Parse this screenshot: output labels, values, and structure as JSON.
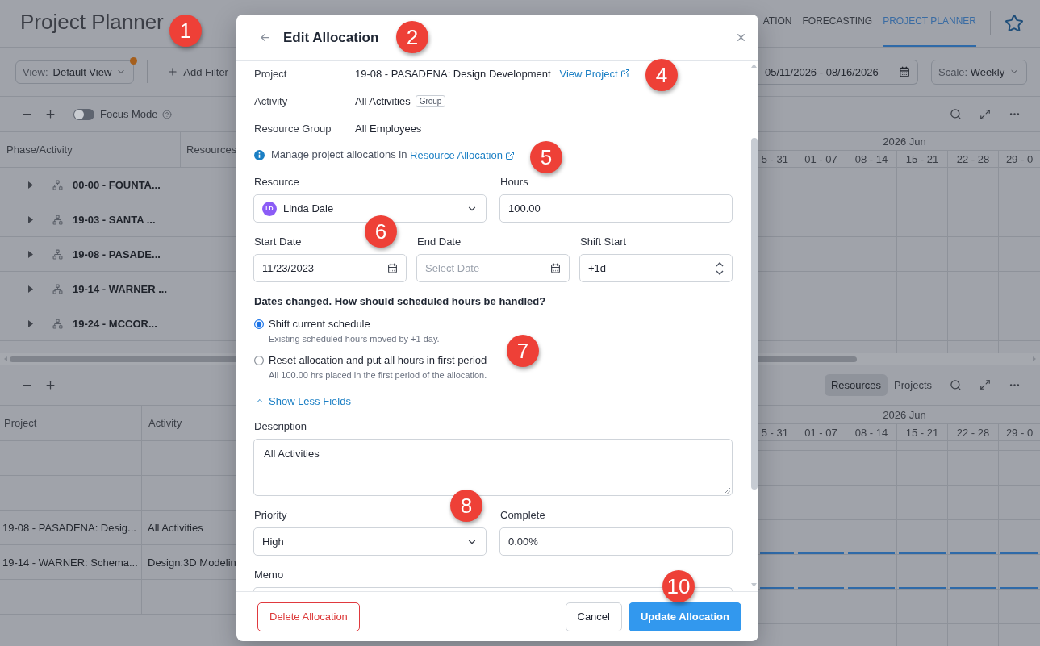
{
  "header": {
    "title": "Project Planner",
    "nav_tabs": [
      {
        "label": "ATION",
        "selected": false
      },
      {
        "label": "FORECASTING",
        "selected": false
      },
      {
        "label": "PROJECT PLANNER",
        "selected": true
      }
    ]
  },
  "toolbar": {
    "view": {
      "label": "View:",
      "value": "Default View",
      "modified": true
    },
    "add_filter": "Add Filter",
    "date_range": "05/11/2026 - 08/16/2026",
    "scale": {
      "label": "Scale:",
      "value": "Weekly"
    }
  },
  "upper_panel": {
    "focus_mode": {
      "label": "Focus Mode",
      "on": false
    },
    "columns": [
      "Phase/Activity",
      "Resources"
    ],
    "timeline": {
      "month": "2026 Jun",
      "weeks": [
        "5 - 31",
        "01 - 07",
        "08 - 14",
        "15 - 21",
        "22 - 28",
        "29 - 0"
      ]
    },
    "rows": [
      {
        "label": "00-00 - FOUNTA...",
        "expanded": false
      },
      {
        "label": "19-03 - SANTA ...",
        "expanded": false
      },
      {
        "label": "19-08 - PASADE...",
        "expanded": false
      },
      {
        "label": "19-14 - WARNER ...",
        "expanded": false
      },
      {
        "label": "19-24 - MCCOR...",
        "expanded": false
      }
    ]
  },
  "lower_panel": {
    "view_toggle": [
      {
        "label": "Resources",
        "selected": true
      },
      {
        "label": "Projects",
        "selected": false
      }
    ],
    "columns": [
      "Project",
      "Activity"
    ],
    "timeline": {
      "month": "2026 Jun",
      "weeks": [
        "5 - 31",
        "01 - 07",
        "08 - 14",
        "15 - 21",
        "22 - 28",
        "29 - 0"
      ]
    },
    "rows": [
      {
        "allocated": false
      },
      {
        "allocated": false
      },
      {
        "project": "19-08 - PASADENA: Desig...",
        "activity": "All Activities",
        "allocated": true
      },
      {
        "project": "19-14 - WARNER: Schema...",
        "activity": "Design:3D Modelin",
        "allocated": true
      },
      {
        "allocated": false
      }
    ]
  },
  "dialog": {
    "title": "Edit Allocation",
    "details": [
      {
        "label": "Project",
        "value": "19-08 - PASADENA: Design Development",
        "link": "View Project"
      },
      {
        "label": "Activity",
        "value": "All Activities",
        "badge": "Group"
      },
      {
        "label": "Resource Group",
        "value": "All Employees"
      }
    ],
    "info": {
      "text": "Manage project allocations in",
      "link": "Resource Allocation"
    },
    "resource": {
      "label": "Resource",
      "value": "Linda Dale",
      "initials": "LD"
    },
    "hours": {
      "label": "Hours",
      "value": "100.00"
    },
    "start_date": {
      "label": "Start Date",
      "value": "11/23/2023"
    },
    "end_date": {
      "label": "End Date",
      "placeholder": "Select Date"
    },
    "shift_start": {
      "label": "Shift Start",
      "value": "+1d"
    },
    "question": "Dates changed. How should scheduled hours be handled?",
    "options": [
      {
        "label": "Shift current schedule",
        "hint": "Existing scheduled hours moved by +1 day.",
        "selected": true
      },
      {
        "label": "Reset allocation and put all hours in first period",
        "hint": "All 100.00 hrs placed in the first period of the allocation.",
        "selected": false
      }
    ],
    "fields_toggle": {
      "label": "Show Less Fields",
      "expanded": true
    },
    "description": {
      "label": "Description",
      "value": "All Activities"
    },
    "priority": {
      "label": "Priority",
      "value": "High"
    },
    "complete": {
      "label": "Complete",
      "value": "0.00%"
    },
    "memo": {
      "label": "Memo"
    },
    "buttons": {
      "delete": "Delete Allocation",
      "cancel": "Cancel",
      "update": "Update Allocation"
    }
  },
  "callouts": [
    "1",
    "2",
    "4",
    "5",
    "6",
    "7",
    "8",
    "10"
  ]
}
